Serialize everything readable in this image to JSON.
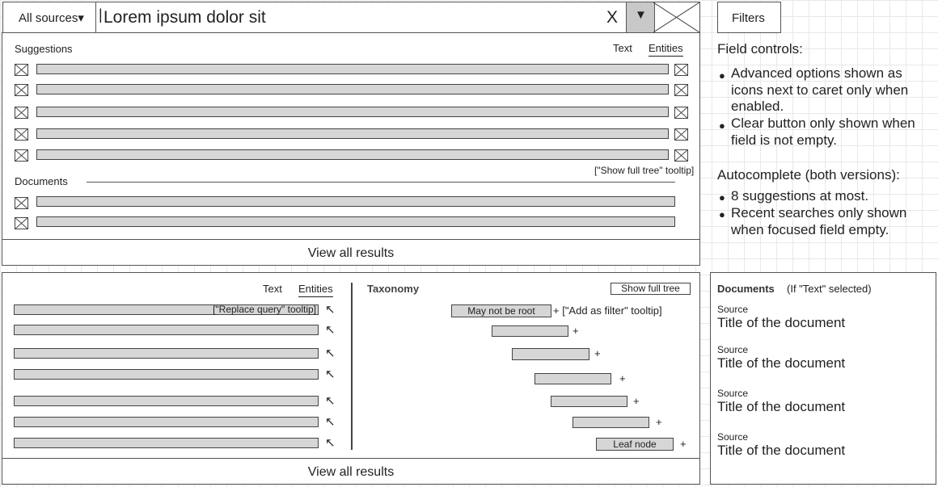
{
  "search": {
    "source_selector": "All sources▾",
    "query": "Lorem ipsum dolor sit",
    "clear": "X",
    "caret": "▼",
    "filters": "Filters"
  },
  "suggest_panel": {
    "heading": "Suggestions",
    "tab_text": "Text",
    "tab_entities": "Entities",
    "show_full_tree_tooltip": "[\"Show full tree\" tooltip]",
    "documents_heading": "Documents",
    "view_all": "View all results"
  },
  "notes": {
    "field_controls_title": "Field controls:",
    "field_controls": [
      "Advanced options shown as icons next to caret only when enabled.",
      "Clear button only shown when field is not empty."
    ],
    "autocomplete_title": "Autocomplete (both versions):",
    "autocomplete": [
      "8 suggestions at most.",
      "Recent searches only shown when focused field empty."
    ],
    "bullet": "●"
  },
  "lower_panel": {
    "tab_text": "Text",
    "tab_entities": "Entities",
    "replace_query_tooltip": "[\"Replace query\" tooltip]",
    "taxonomy_heading": "Taxonomy",
    "show_full_tree_btn": "Show full tree",
    "root_node": "May not be root",
    "add_filter_tooltip": "+ [\"Add as filter\" tooltip]",
    "leaf_node": "Leaf node",
    "plus": "+",
    "arrow": "↖",
    "view_all": "View all results"
  },
  "docs_panel": {
    "heading": "Documents",
    "condition": "(If \"Text\" selected)",
    "items": [
      {
        "source": "Source",
        "title": "Title of the document"
      },
      {
        "source": "Source",
        "title": "Title of the document"
      },
      {
        "source": "Source",
        "title": "Title of the document"
      },
      {
        "source": "Source",
        "title": "Title of the document"
      }
    ]
  }
}
